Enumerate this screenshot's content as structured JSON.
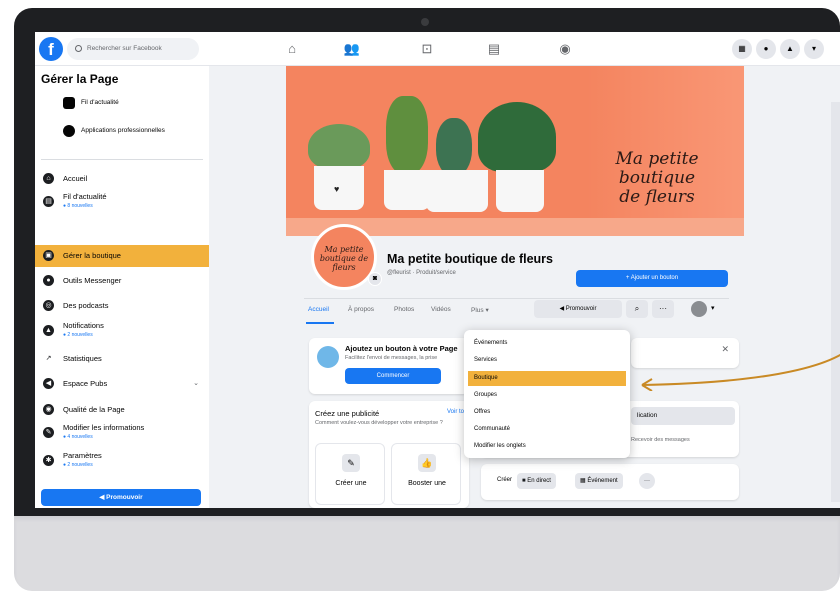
{
  "topbar": {
    "logo": "f",
    "search_placeholder": "Rechercher sur Facebook"
  },
  "sidebar": {
    "title": "Gérer la Page",
    "quick_links": [
      {
        "label": "Fil d'actualité"
      },
      {
        "label": "Applications professionnelles"
      }
    ],
    "items": [
      {
        "label": "Accueil",
        "sub": ""
      },
      {
        "label": "Fil d'actualité",
        "sub": "● 8 nouvelles"
      },
      {
        "label": "Gérer la boutique",
        "sub": ""
      },
      {
        "label": "Outils Messenger",
        "sub": ""
      },
      {
        "label": "Des podcasts",
        "sub": ""
      },
      {
        "label": "Notifications",
        "sub": "● 2 nouvelles"
      },
      {
        "label": "Statistiques",
        "sub": ""
      },
      {
        "label": "Espace Pubs",
        "sub": ""
      },
      {
        "label": "Qualité de la Page",
        "sub": ""
      },
      {
        "label": "Modifier les informations",
        "sub": "● 4 nouvelles"
      },
      {
        "label": "Paramètres",
        "sub": "● 2 nouvelles"
      }
    ],
    "promote_button": "Promouvoir"
  },
  "cover": {
    "text_line1": "Ma petite boutique",
    "text_line2": "de fleurs"
  },
  "page": {
    "avatar_text": "Ma petite boutique de fleurs",
    "name": "Ma petite boutique de fleurs",
    "category": "@fleurist · Produit/service",
    "cta_button": "+ Ajouter un bouton",
    "tabs": [
      "Accueil",
      "À propos",
      "Photos",
      "Vidéos",
      "Plus ▾"
    ],
    "promote_button": "Promouvoir",
    "search_icon": "⌕",
    "more_icon": "···",
    "account_arrow": "▾"
  },
  "add_button_card": {
    "title": "Ajoutez un bouton à votre Page",
    "text": "Facilitez l'envoi de messages, la prise",
    "button": "Commencer",
    "close": "✕"
  },
  "create_ad_card": {
    "title": "Créez une publicité",
    "link": "Voir tout",
    "text": "Comment voulez-vous développer votre entreprise ?",
    "tiles": [
      {
        "label": "Créer une",
        "icon": "✎"
      },
      {
        "label": "Booster une",
        "icon": "👍"
      }
    ]
  },
  "right_card": {
    "button": "lication",
    "text": "Recevoir des messages"
  },
  "composer": {
    "label": "Créer",
    "live": "En direct",
    "event": "Événement",
    "more": "···"
  },
  "dropdown": {
    "items": [
      "Événements",
      "Services",
      "Boutique",
      "Groupes",
      "Offres",
      "Communauté",
      "Modifier les onglets"
    ],
    "selected": "Boutique"
  },
  "colors": {
    "facebook_blue": "#1877f2",
    "highlight": "#f2b13c",
    "cover": "#f4845f",
    "arrow": "#c98a25"
  }
}
